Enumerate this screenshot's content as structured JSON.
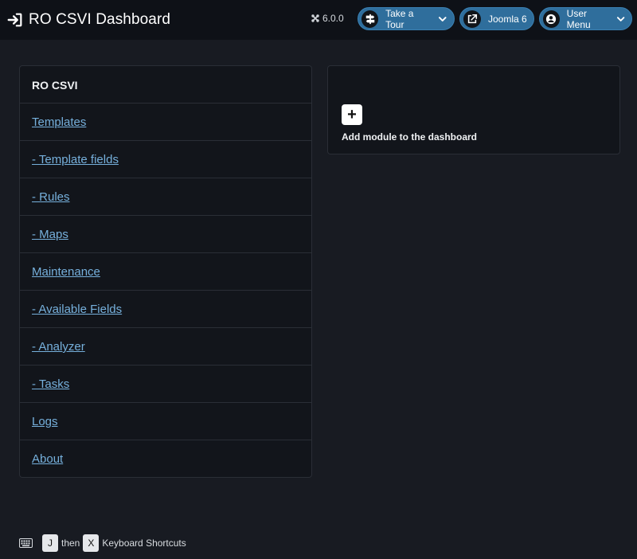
{
  "header": {
    "title": "RO CSVI Dashboard",
    "title_icon": "sign-in-icon",
    "version": "6.0.0",
    "buttons": {
      "tour": "Take a Tour",
      "joomla": "Joomla 6",
      "user": "User Menu"
    }
  },
  "sidebar": {
    "title": "RO CSVI",
    "items": [
      {
        "label": "Templates"
      },
      {
        "label": "- Template fields"
      },
      {
        "label": "- Rules"
      },
      {
        "label": "- Maps"
      },
      {
        "label": "Maintenance"
      },
      {
        "label": "- Available Fields"
      },
      {
        "label": "- Analyzer"
      },
      {
        "label": "- Tasks"
      },
      {
        "label": "Logs"
      },
      {
        "label": "About"
      }
    ]
  },
  "dashboard": {
    "add_module_label": "Add module to the dashboard",
    "plus_symbol": "+"
  },
  "shortcuts": {
    "key1": "J",
    "then": "then",
    "key2": "X",
    "label": "Keyboard Shortcuts"
  },
  "colors": {
    "background": "#181b22",
    "header": "#0e1117",
    "link": "#76b0dc",
    "pill": "#2f6e9c"
  }
}
